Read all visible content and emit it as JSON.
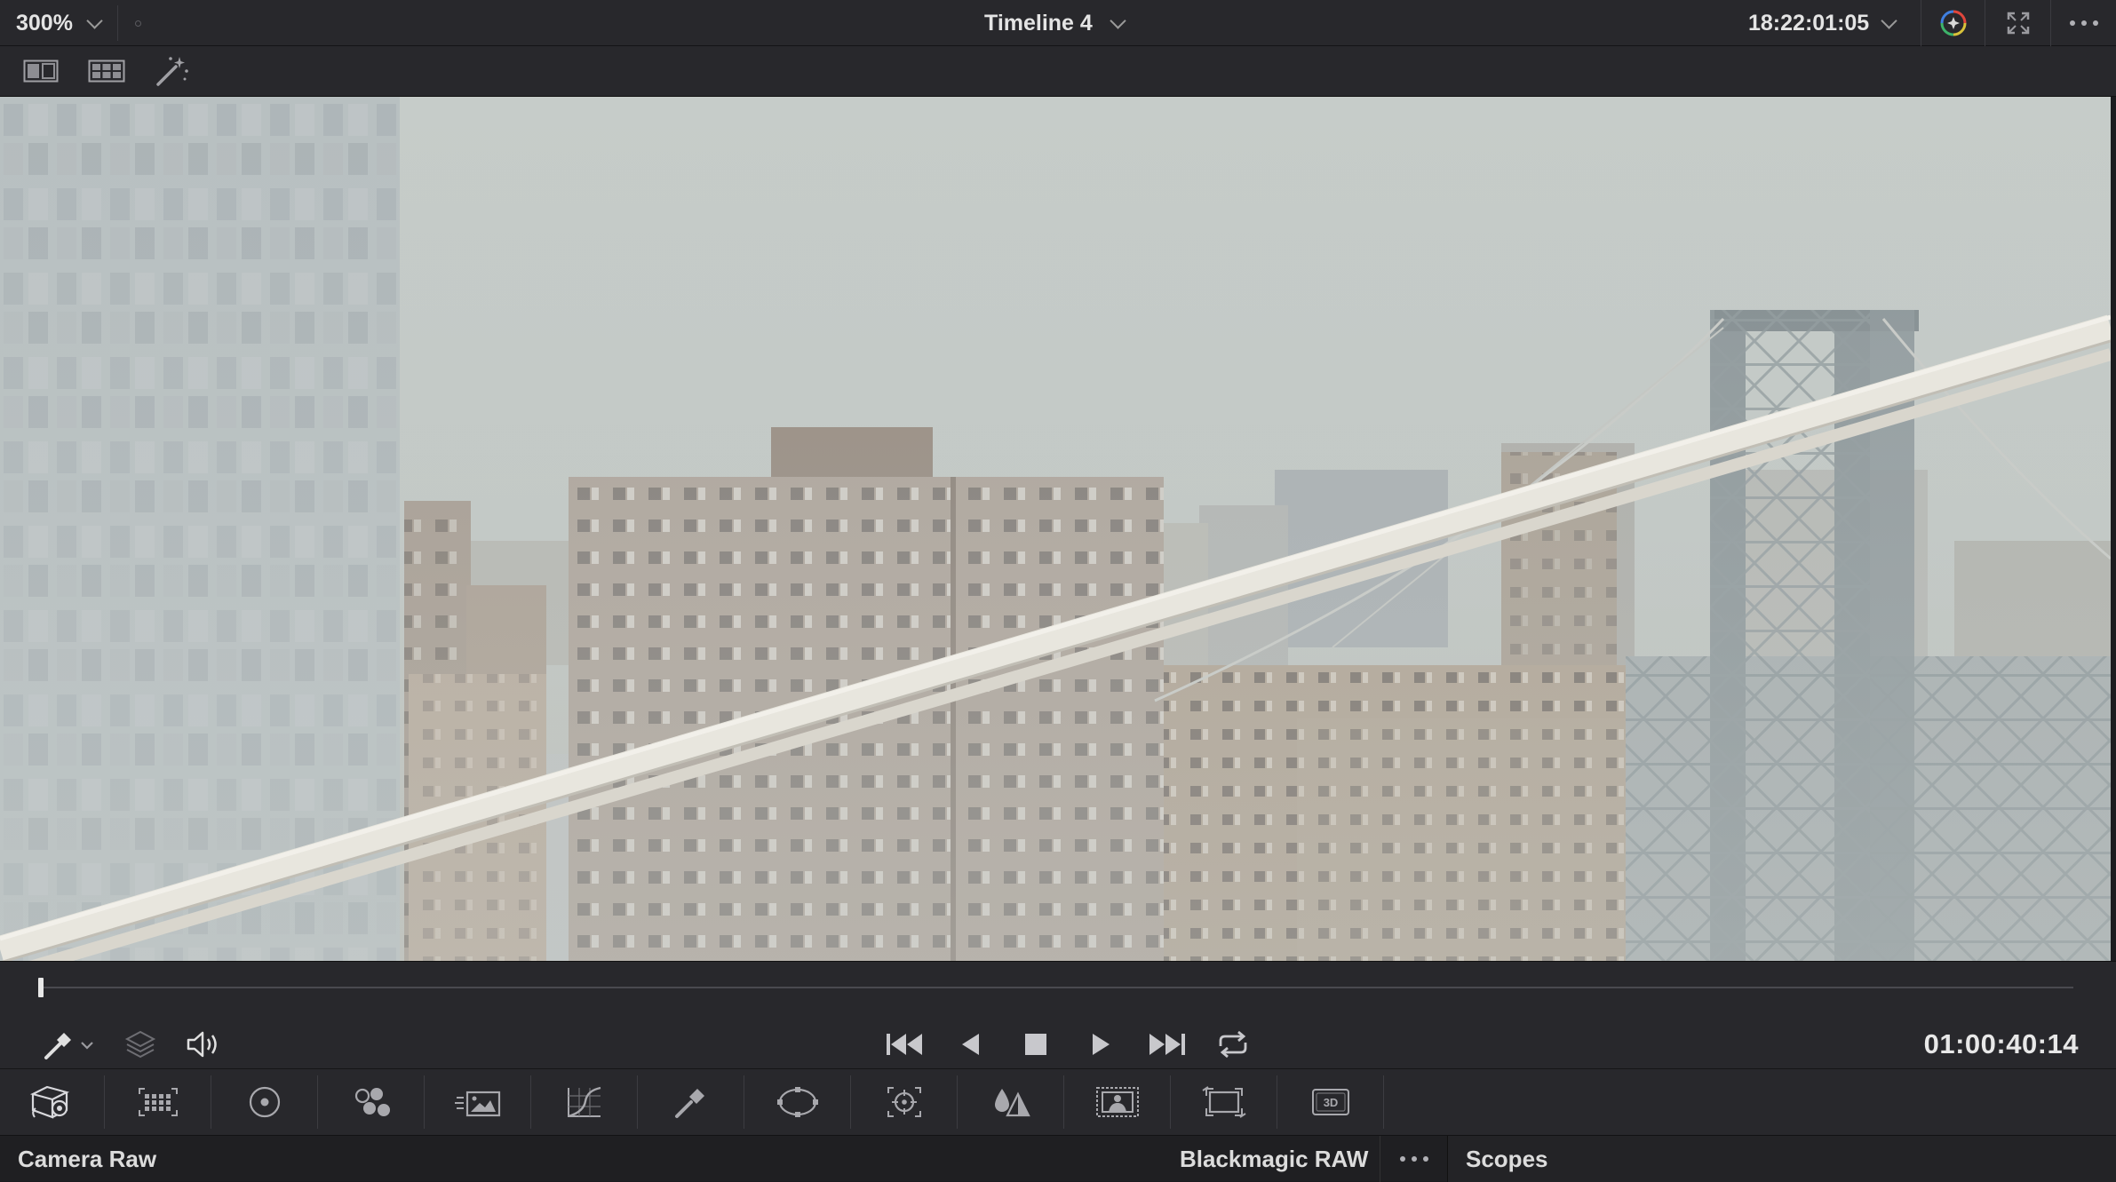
{
  "top_bar": {
    "zoom_label": "300%",
    "timeline_name": "Timeline 4",
    "source_timecode": "18:22:01:05"
  },
  "toolbar2": {
    "icons": [
      "split-screen-icon",
      "gallery-grid-icon",
      "magic-wand-icon"
    ]
  },
  "transport": {
    "playhead_fraction": 0.0,
    "record_timecode": "01:00:40:14"
  },
  "palette": {
    "icons": [
      "camera-raw-icon",
      "color-match-icon",
      "color-wheels-icon",
      "rgb-mixer-icon",
      "motion-effects-icon",
      "curves-icon",
      "qualifier-icon",
      "window-icon",
      "tracker-icon",
      "blur-icon",
      "key-icon",
      "sizing-icon",
      "3d-icon"
    ],
    "badge_3d": "3D"
  },
  "bottom": {
    "left_panel_label": "Camera Raw",
    "raw_format_label": "Blackmagic RAW",
    "right_tab_label": "Scopes"
  },
  "colors": {
    "panel_bg": "#28282c",
    "dark_bg": "#1c1c1f",
    "text": "#e4e4e4",
    "icon": "#a8a8ad"
  }
}
